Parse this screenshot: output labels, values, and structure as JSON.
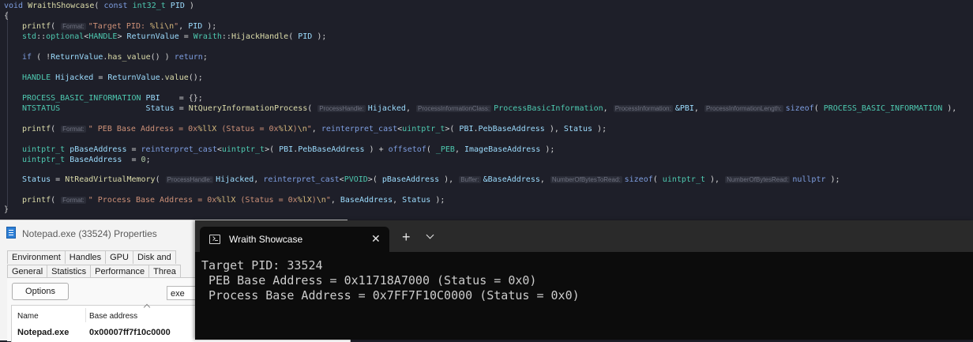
{
  "code": {
    "l1": {
      "t1": "void",
      "t2": "WraithShowcase",
      "t3": "( ",
      "t4": "const",
      "t5": "int32_t",
      "t6": "PID",
      "t7": " )"
    },
    "l2": {
      "t1": "{"
    },
    "l3": {
      "t1": "printf",
      "t2": "( ",
      "h1": "Format:",
      "t3": "\"Target PID: ",
      "t4": "%li\\n",
      "t5": "\"",
      "t6": ", ",
      "t7": "PID",
      "t8": " );"
    },
    "l4": {
      "t1": "std",
      "t2": "::",
      "t3": "optional",
      "t4": "<",
      "t5": "HANDLE",
      "t6": "> ",
      "t7": "ReturnValue",
      "t8": " = ",
      "t9": "Wraith",
      "t10": "::",
      "t11": "HijackHandle",
      "t12": "( ",
      "t13": "PID",
      "t14": " );"
    },
    "l5": {
      "t1": "if",
      "t2": " ( !",
      "t3": "ReturnValue",
      "t4": ".",
      "t5": "has_value",
      "t6": "() ) ",
      "t7": "return",
      "t8": ";"
    },
    "l6": {
      "t1": "HANDLE",
      "t2": " ",
      "t3": "Hijacked",
      "t4": " = ",
      "t5": "ReturnValue",
      "t6": ".",
      "t7": "value",
      "t8": "();"
    },
    "l7": {
      "t1": "PROCESS_BASIC_INFORMATION",
      "t2": " ",
      "t3": "PBI",
      "t4": "    = {};"
    },
    "l8": {
      "t1": "NTSTATUS",
      "t2": "                  ",
      "t3": "Status",
      "t4": " = ",
      "t5": "NtQueryInformationProcess",
      "t6": "( ",
      "h1": "ProcessHandle:",
      "t7": "Hijacked",
      "t8": ", ",
      "h2": "ProcessInformationClass:",
      "t9": "ProcessBasicInformation",
      "t10": ", ",
      "h3": "ProcessInformation:",
      "t11": "&PBI",
      "t12": ", ",
      "h4": "ProcessInformationLength:",
      "t13": "sizeof",
      "t14": "( ",
      "t15": "PROCESS_BASIC_INFORMATION",
      "t16": " ),"
    },
    "l9": {
      "t1": "printf",
      "t2": "( ",
      "h1": "Format:",
      "t3": "\" PEB Base Address = 0x",
      "t4": "%llX",
      "t5": " (Status = 0x",
      "t6": "%lX",
      "t7": ")",
      "t8": "\\n",
      "t9": "\"",
      "t10": ", ",
      "t11": "reinterpret_cast",
      "t12": "<",
      "t13": "uintptr_t",
      "t14": ">( ",
      "t15": "PBI",
      "t16": ".",
      "t17": "PebBaseAddress",
      "t18": " ), ",
      "t19": "Status",
      "t20": " );"
    },
    "l10": {
      "t1": "uintptr_t",
      "t2": " ",
      "t3": "pBaseAddress",
      "t4": " = ",
      "t5": "reinterpret_cast",
      "t6": "<",
      "t7": "uintptr_t",
      "t8": ">( ",
      "t9": "PBI",
      "t10": ".",
      "t11": "PebBaseAddress",
      "t12": " ) + ",
      "t13": "offsetof",
      "t14": "( ",
      "t15": "_PEB",
      "t16": ", ",
      "t17": "ImageBaseAddress",
      "t18": " );"
    },
    "l11": {
      "t1": "uintptr_t",
      "t2": " ",
      "t3": "BaseAddress",
      "t4": "  = ",
      "t5": "0",
      "t6": ";"
    },
    "l12": {
      "t1": "Status",
      "t2": " = ",
      "t3": "NtReadVirtualMemory",
      "t4": "( ",
      "h1": "ProcessHandle:",
      "t5": "Hijacked",
      "t6": ", ",
      "t7": "reinterpret_cast",
      "t8": "<",
      "t9": "PVOID",
      "t10": ">( ",
      "t11": "pBaseAddress",
      "t12": " ), ",
      "h2": "Buffer:",
      "t13": "&BaseAddress",
      "t14": ", ",
      "h3": "NumberOfBytesToRead:",
      "t15": "sizeof",
      "t16": "( ",
      "t17": "uintptr_t",
      "t18": " ), ",
      "h4": "NumberOfBytesRead:",
      "t19": "nullptr",
      "t20": " );"
    },
    "l13": {
      "t1": "printf",
      "t2": "( ",
      "h1": "Format:",
      "t3": "\" Process Base Address = 0x",
      "t4": "%llX",
      "t5": " (Status = 0x",
      "t6": "%lX",
      "t7": ")",
      "t8": "\\n",
      "t9": "\"",
      "t10": ", ",
      "t11": "BaseAddress",
      "t12": ", ",
      "t13": "Status",
      "t14": " );"
    },
    "l14": {
      "t1": "}"
    }
  },
  "properties": {
    "title": "Notepad.exe (33524) Properties",
    "tabs_row1": [
      "Environment",
      "Handles",
      "GPU",
      "Disk and"
    ],
    "tabs_row2": [
      "General",
      "Statistics",
      "Performance",
      "Threa"
    ],
    "options_label": "Options",
    "filter_value": "exe",
    "columns": {
      "name": "Name",
      "base": "Base address"
    },
    "row": {
      "name": "Notepad.exe",
      "base": "0x00007ff7f10c0000"
    }
  },
  "terminal": {
    "tab_title": "Wraith Showcase",
    "close_glyph": "✕",
    "new_tab_glyph": "+",
    "lines": [
      "Target PID: 33524",
      " PEB Base Address = 0x11718A7000 (Status = 0x0)",
      " Process Base Address = 0x7FF7F10C0000 (Status = 0x0)"
    ]
  },
  "icons": {
    "properties": "document-icon",
    "terminal": "terminal-icon",
    "dropdown": "chevron-down-icon"
  }
}
